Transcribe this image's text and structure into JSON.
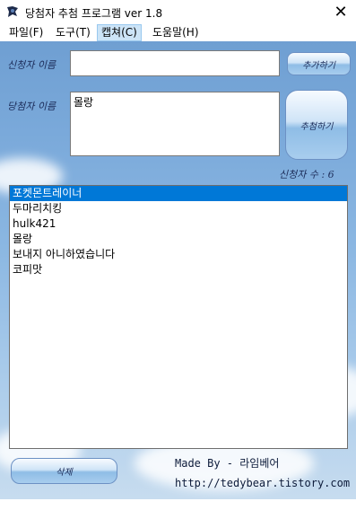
{
  "window": {
    "title": "당첨자 추첨 프로그램 ver 1.8",
    "close_glyph": "✕"
  },
  "menu": [
    {
      "label": "파일(F)"
    },
    {
      "label": "도구(T)"
    },
    {
      "label": "캡쳐(C)"
    },
    {
      "label": "도움말(H)"
    }
  ],
  "form": {
    "applicant_label": "신청자 이름",
    "applicant_value": "",
    "winner_label": "당첨자 이름",
    "winner_value": "몰랑",
    "add_button": "추가하기",
    "draw_button": "추첨하기",
    "count_label": "신청자 수 : 6"
  },
  "list": {
    "items": [
      "포켓몬트레이너",
      "두마리치킹",
      "hulk421",
      "몰랑",
      "보내지 아니하였습니다",
      "코피맛"
    ],
    "selected_index": 0
  },
  "footer": {
    "delete_button": "삭제",
    "made_by": "Made By - 라임베어",
    "url": "http://tedybear.tistory.com"
  },
  "colors": {
    "accent": "#0078d7",
    "sky_top": "#6f9fd2",
    "sky_bottom": "#c7dcef"
  }
}
